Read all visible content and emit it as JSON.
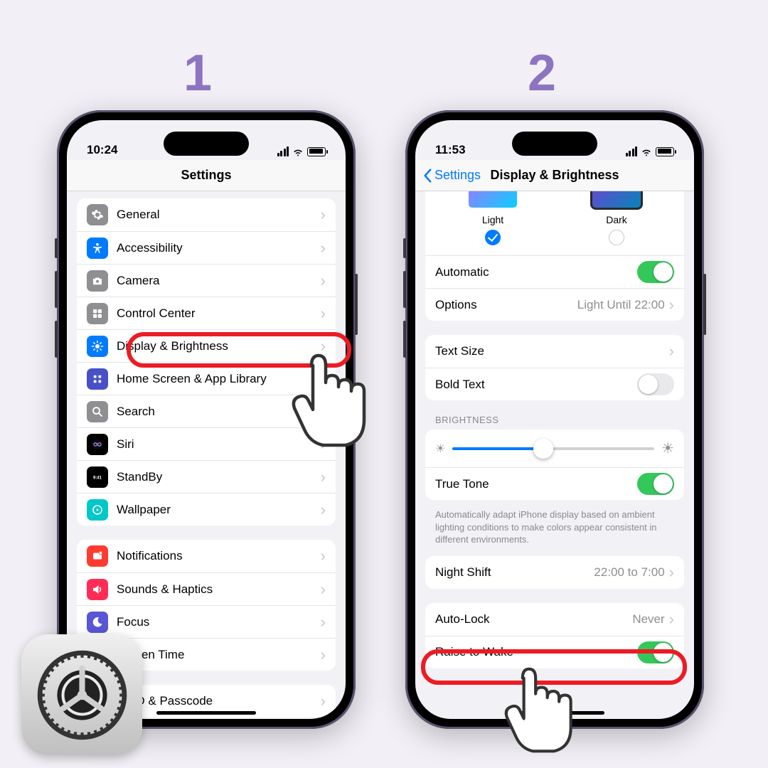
{
  "steps": {
    "one": "1",
    "two": "2"
  },
  "phone1": {
    "time": "10:24",
    "title": "Settings",
    "items": [
      {
        "key": "general",
        "label": "General",
        "icon_bg": "#8e8e93"
      },
      {
        "key": "accessibility",
        "label": "Accessibility",
        "icon_bg": "#007aff"
      },
      {
        "key": "camera",
        "label": "Camera",
        "icon_bg": "#8e8e93"
      },
      {
        "key": "control-center",
        "label": "Control Center",
        "icon_bg": "#8e8e93"
      },
      {
        "key": "display",
        "label": "Display & Brightness",
        "icon_bg": "#007aff"
      },
      {
        "key": "home",
        "label": "Home Screen & App Library",
        "icon_bg": "#4850c8"
      },
      {
        "key": "search",
        "label": "Search",
        "icon_bg": "#8e8e93"
      },
      {
        "key": "siri",
        "label": "Siri",
        "icon_bg": "#000000"
      },
      {
        "key": "standby",
        "label": "StandBy",
        "icon_bg": "#000000"
      },
      {
        "key": "wallpaper",
        "label": "Wallpaper",
        "icon_bg": "#00c8c8"
      }
    ],
    "items2": [
      {
        "key": "notifications",
        "label": "Notifications",
        "icon_bg": "#ff3b30"
      },
      {
        "key": "sounds",
        "label": "Sounds & Haptics",
        "icon_bg": "#ff2d55"
      },
      {
        "key": "focus",
        "label": "Focus",
        "icon_bg": "#5856d6",
        "partial": "cus"
      },
      {
        "key": "screentime",
        "label": "Screen Time",
        "icon_bg": "#5856d6",
        "partial": "reen Time"
      }
    ],
    "items3": [
      {
        "key": "faceid",
        "partial": "ce ID & Passcode"
      }
    ]
  },
  "phone2": {
    "time": "11:53",
    "back": "Settings",
    "title": "Display & Brightness",
    "light": "Light",
    "dark": "Dark",
    "automatic": "Automatic",
    "options": "Options",
    "options_value": "Light Until 22:00",
    "text_size": "Text Size",
    "bold_text": "Bold Text",
    "brightness_header": "BRIGHTNESS",
    "brightness_pct": 45,
    "true_tone": "True Tone",
    "true_tone_footer": "Automatically adapt iPhone display based on ambient lighting conditions to make colors appear consistent in different environments.",
    "night_shift": "Night Shift",
    "night_shift_value": "22:00 to 7:00",
    "auto_lock": "Auto-Lock",
    "auto_lock_value": "Never",
    "raise_to_wake": "Raise to Wake"
  },
  "colors": {
    "accent_purple": "#8d74c0",
    "highlight_red": "#ec1b24",
    "ios_blue": "#007aff",
    "ios_green": "#34c759"
  }
}
